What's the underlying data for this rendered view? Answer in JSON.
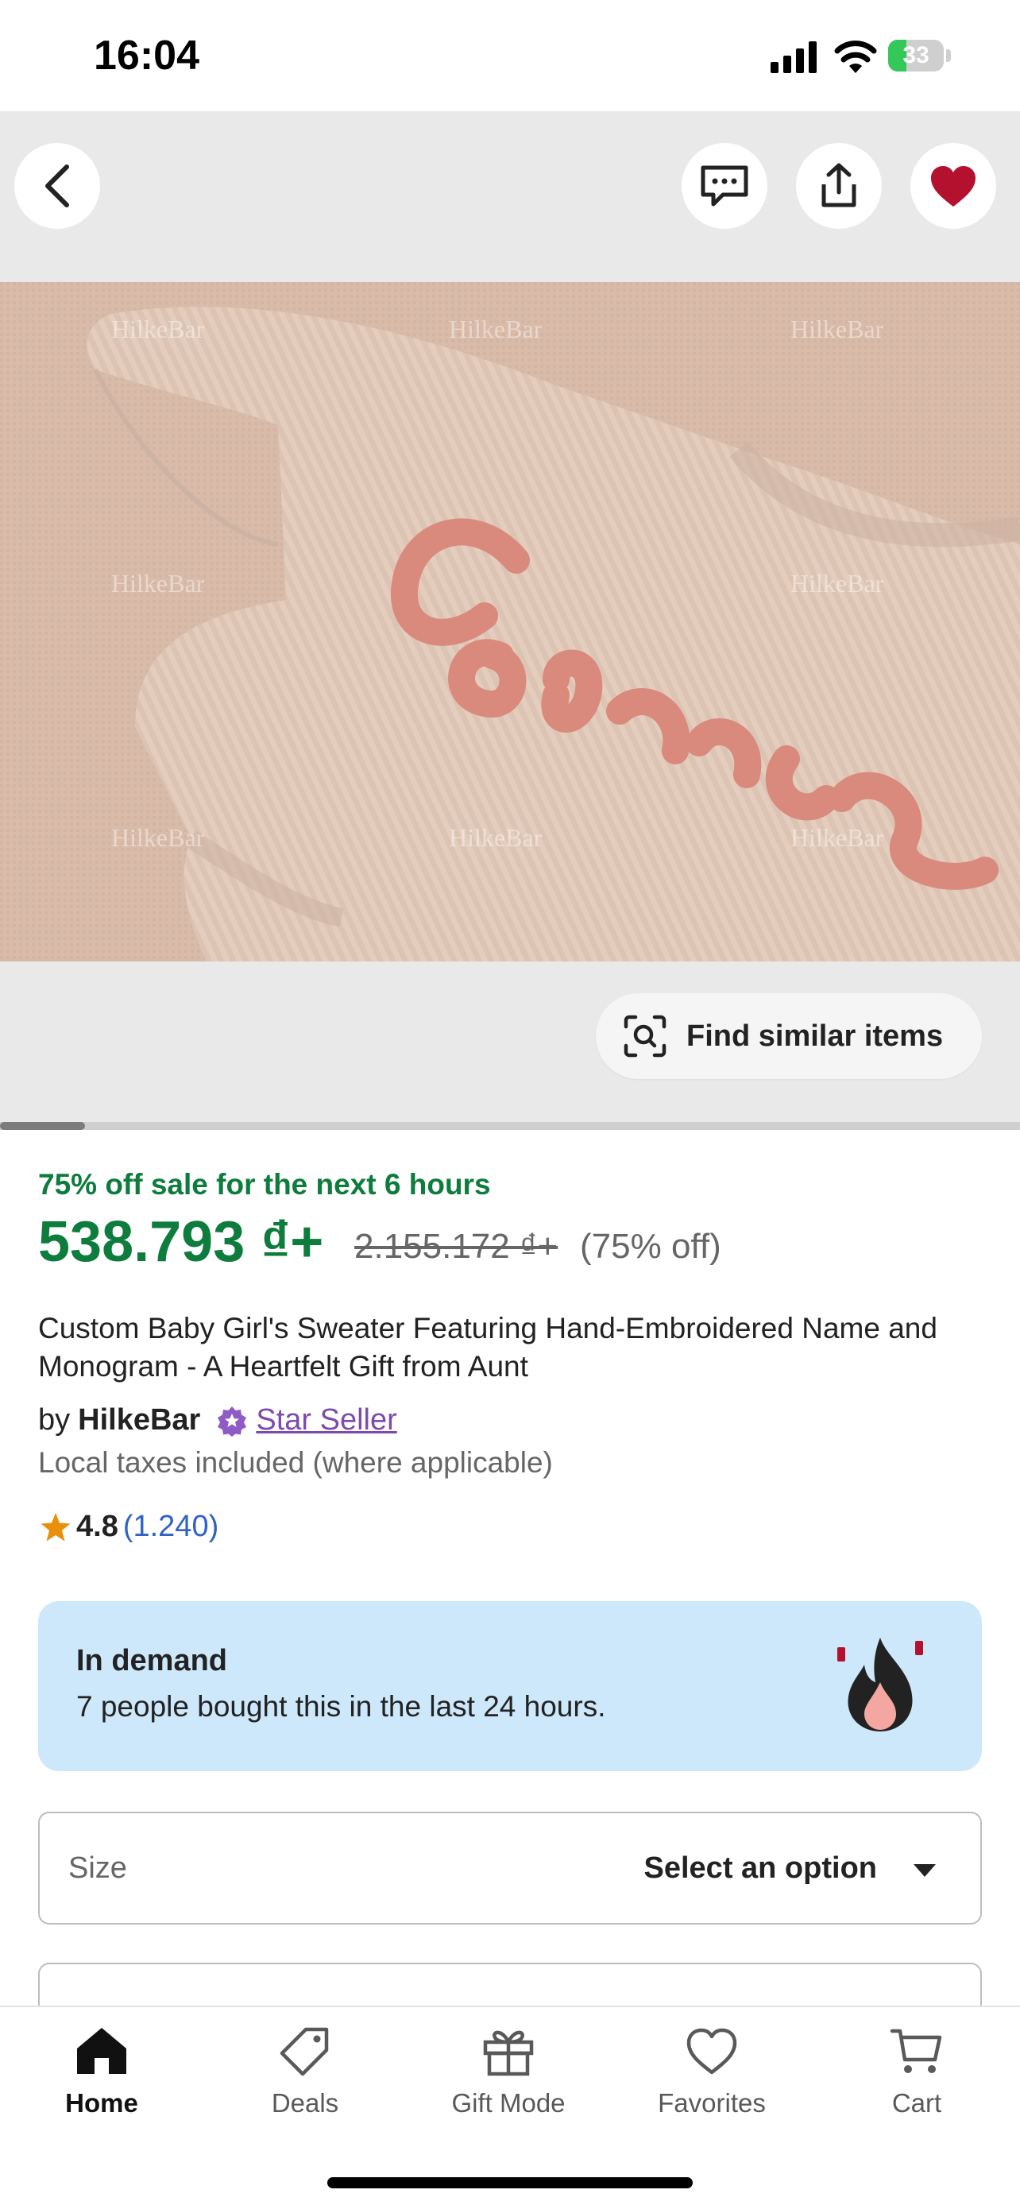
{
  "status_bar": {
    "time": "16:04",
    "battery": "33",
    "battery_level": 0.33
  },
  "gallery": {
    "watermark": "HilkeBar",
    "embroidered_name": "Conner",
    "find_similar_label": "Find similar items",
    "image_position": 0.083
  },
  "product": {
    "sale_notice": "75% off sale for the next 6 hours",
    "current_price": "538.793 ₫+",
    "original_price": "2.155.172 ₫+",
    "discount": "(75% off)",
    "title": "Custom Baby Girl's Sweater Featuring Hand-Embroidered Name and Monogram - A Heartfelt Gift from Aunt",
    "seller_by": "by",
    "seller_name": "HilkeBar",
    "star_seller_label": "Star Seller",
    "tax_note": "Local taxes included (where applicable)",
    "rating": "4.8",
    "review_count": "(1.240)"
  },
  "in_demand": {
    "title": "In demand",
    "text": "7 people bought this in the last 24 hours."
  },
  "size_select": {
    "label": "Size",
    "value": "Select an option"
  },
  "tab_bar": {
    "tabs": [
      {
        "label": "Home",
        "icon": "home-icon",
        "active": true
      },
      {
        "label": "Deals",
        "icon": "tag-icon",
        "active": false
      },
      {
        "label": "Gift Mode",
        "icon": "gift-icon",
        "active": false
      },
      {
        "label": "Favorites",
        "icon": "heart-outline-icon",
        "active": false
      },
      {
        "label": "Cart",
        "icon": "cart-icon",
        "active": false
      }
    ]
  },
  "colors": {
    "sale_green": "#0d7c3c",
    "star_seller_purple": "#7e4bad",
    "link_blue": "#2f63c5",
    "in_demand_bg": "#cde8fb",
    "favorite_red": "#b3112e"
  }
}
